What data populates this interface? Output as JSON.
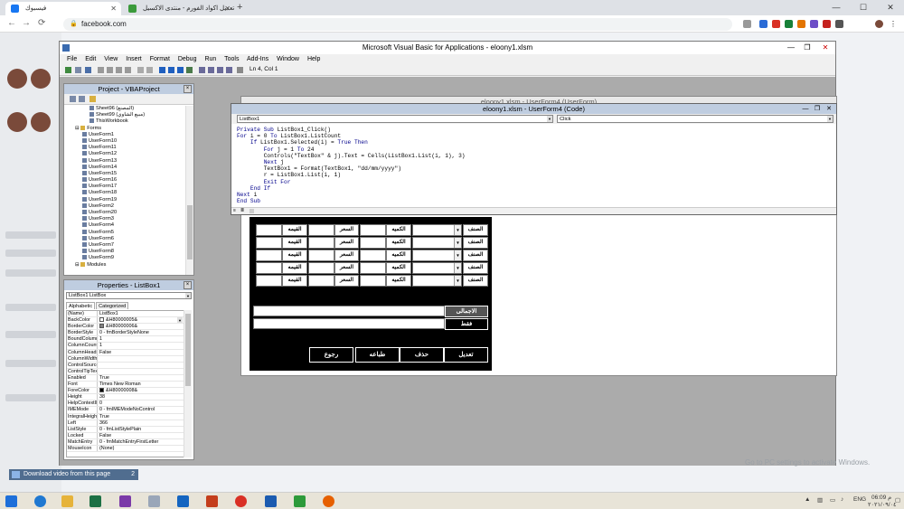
{
  "browser": {
    "tabs": [
      {
        "title": "فيسبوك",
        "active": true
      },
      {
        "title": "تعديل اكواد الفورم - منتدى الاكسيل",
        "active": false
      }
    ],
    "url": "facebook.com",
    "new_tab": "+",
    "win_min": "—",
    "win_max": "☐",
    "win_close": "✕"
  },
  "vbe": {
    "title": "Microsoft Visual Basic for Applications - eloony1.xlsm",
    "menu": [
      "File",
      "Edit",
      "View",
      "Insert",
      "Format",
      "Debug",
      "Run",
      "Tools",
      "Add-Ins",
      "Window",
      "Help"
    ],
    "cursor_pos": "Ln 4, Col 1"
  },
  "project": {
    "title": "Project - VBAProject",
    "items": [
      {
        "label": "Sheet96 (المصنع)",
        "indent": 3
      },
      {
        "label": "Sheet99 (مبيع الشاوي)",
        "indent": 3
      },
      {
        "label": "ThisWorkbook",
        "indent": 3
      },
      {
        "label": "Forms",
        "indent": 1,
        "folder": true
      },
      {
        "label": "UserForm1",
        "indent": 2
      },
      {
        "label": "UserForm10",
        "indent": 2
      },
      {
        "label": "UserForm11",
        "indent": 2
      },
      {
        "label": "UserForm12",
        "indent": 2
      },
      {
        "label": "UserForm13",
        "indent": 2
      },
      {
        "label": "UserForm14",
        "indent": 2
      },
      {
        "label": "UserForm15",
        "indent": 2
      },
      {
        "label": "UserForm16",
        "indent": 2
      },
      {
        "label": "UserForm17",
        "indent": 2
      },
      {
        "label": "UserForm18",
        "indent": 2
      },
      {
        "label": "UserForm19",
        "indent": 2
      },
      {
        "label": "UserForm2",
        "indent": 2
      },
      {
        "label": "UserForm20",
        "indent": 2
      },
      {
        "label": "UserForm3",
        "indent": 2
      },
      {
        "label": "UserForm4",
        "indent": 2
      },
      {
        "label": "UserForm5",
        "indent": 2
      },
      {
        "label": "UserForm6",
        "indent": 2
      },
      {
        "label": "UserForm7",
        "indent": 2
      },
      {
        "label": "UserForm8",
        "indent": 2
      },
      {
        "label": "UserForm9",
        "indent": 2
      },
      {
        "label": "Modules",
        "indent": 1,
        "folder": true
      }
    ]
  },
  "properties": {
    "title": "Properties - ListBox1",
    "object": "ListBox1 ListBox",
    "tabs": [
      "Alphabetic",
      "Categorized"
    ],
    "rows": [
      {
        "name": "(Name)",
        "value": "ListBox1"
      },
      {
        "name": "BackColor",
        "value": "&H80000005&",
        "swatch": "#ffffff",
        "dropdown": true
      },
      {
        "name": "BorderColor",
        "value": "&H80000006&",
        "swatch": "#808080"
      },
      {
        "name": "BorderStyle",
        "value": "0 - fmBorderStyleNone"
      },
      {
        "name": "BoundColumn",
        "value": "1"
      },
      {
        "name": "ColumnCount",
        "value": "1"
      },
      {
        "name": "ColumnHeads",
        "value": "False"
      },
      {
        "name": "ColumnWidths",
        "value": ""
      },
      {
        "name": "ControlSource",
        "value": ""
      },
      {
        "name": "ControlTipText",
        "value": ""
      },
      {
        "name": "Enabled",
        "value": "True"
      },
      {
        "name": "Font",
        "value": "Times New Roman"
      },
      {
        "name": "ForeColor",
        "value": "&H80000008&",
        "swatch": "#000000"
      },
      {
        "name": "Height",
        "value": "38"
      },
      {
        "name": "HelpContextID",
        "value": "0"
      },
      {
        "name": "IMEMode",
        "value": "0 - fmIMEModeNoControl"
      },
      {
        "name": "IntegralHeight",
        "value": "True"
      },
      {
        "name": "Left",
        "value": "366"
      },
      {
        "name": "ListStyle",
        "value": "0 - fmListStylePlain"
      },
      {
        "name": "Locked",
        "value": "False"
      },
      {
        "name": "MatchEntry",
        "value": "0 - fmMatchEntryFirstLetter"
      },
      {
        "name": "MouseIcon",
        "value": "(None)"
      }
    ]
  },
  "designer": {
    "title": "eloony1.xlsm - UserForm4 (UserForm)",
    "labels": {
      "value": "القيمه",
      "price": "السعر",
      "qty": "الكميه",
      "item": "الصنف"
    },
    "total_label": "الاجمالى",
    "words_label": "فقط",
    "buttons": [
      "تعديل",
      "حذف",
      "طباعه",
      "رجوع"
    ]
  },
  "code_window": {
    "title": "eloony1.xlsm - UserForm4 (Code)",
    "object_combo": "ListBox1",
    "proc_combo": "Click",
    "lines": [
      [
        [
          "kw",
          "Private Sub"
        ],
        [
          "t",
          " ListBox1_Click()"
        ]
      ],
      [
        [
          "kw",
          "For"
        ],
        [
          "t",
          " i = 0 "
        ],
        [
          "kw",
          "To"
        ],
        [
          "t",
          " ListBox1.ListCount"
        ]
      ],
      [
        [
          "t",
          "    "
        ],
        [
          "kw",
          "If"
        ],
        [
          "t",
          " ListBox1.Selected(i) = "
        ],
        [
          "kw",
          "True Then"
        ]
      ],
      [
        [
          "t",
          "        "
        ],
        [
          "kw",
          "For"
        ],
        [
          "t",
          " j = 1 "
        ],
        [
          "kw",
          "To"
        ],
        [
          "t",
          " 24"
        ]
      ],
      [
        [
          "t",
          "        Controls(\"TextBox\" & j).Text = Cells(ListBox1.List(i, 1), 3)"
        ]
      ],
      [
        [
          "t",
          "        "
        ],
        [
          "kw",
          "Next"
        ],
        [
          "t",
          " j"
        ]
      ],
      [
        [
          "t",
          "        TextBox1 = Format(TextBox1, \"dd/mm/yyyy\")"
        ]
      ],
      [
        [
          "t",
          "        r = ListBox1.List(i, 1)"
        ]
      ],
      [
        [
          "t",
          "        "
        ],
        [
          "kw",
          "Exit For"
        ]
      ],
      [
        [
          "t",
          "    "
        ],
        [
          "kw",
          "End If"
        ]
      ],
      [
        [
          "kw",
          "Next"
        ],
        [
          "t",
          " i"
        ]
      ],
      [
        [
          "kw",
          "End Sub"
        ]
      ]
    ]
  },
  "taskbar": {
    "download_label": "Download video from this page",
    "download_count": "2",
    "watermark": "Go to PC settings to activate Windows.",
    "lang": "ENG",
    "time": "06:09 م",
    "date": "٢٠٢١/٠٩/٠٤"
  },
  "colors": {
    "fb_blue": "#1877f2",
    "vba_title_blue": "#bfcde0",
    "form_black": "#000000"
  }
}
